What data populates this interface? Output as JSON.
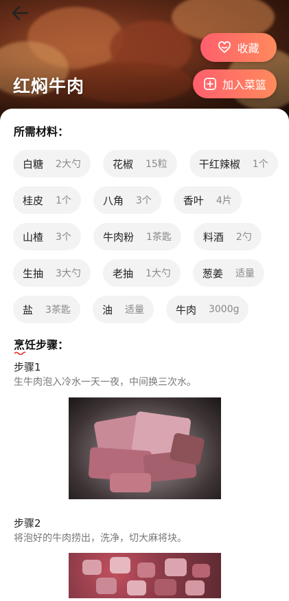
{
  "header": {
    "title": "红焖牛肉",
    "favorite_label": "收藏",
    "add_basket_label": "加入菜篮"
  },
  "ingredients": {
    "heading": "所需材料：",
    "items": [
      {
        "name": "白糖",
        "qty": "2大勺"
      },
      {
        "name": "花椒",
        "qty": "15粒"
      },
      {
        "name": "干红辣椒",
        "qty": "1个"
      },
      {
        "name": "桂皮",
        "qty": "1个"
      },
      {
        "name": "八角",
        "qty": "3个"
      },
      {
        "name": "香叶",
        "qty": "4片"
      },
      {
        "name": "山楂",
        "qty": "3个"
      },
      {
        "name": "牛肉粉",
        "qty": "1茶匙"
      },
      {
        "name": "料酒",
        "qty": "2勺"
      },
      {
        "name": "生抽",
        "qty": "3大勺"
      },
      {
        "name": "老抽",
        "qty": "1大勺"
      },
      {
        "name": "葱姜",
        "qty": "适量"
      },
      {
        "name": "盐",
        "qty": "3茶匙"
      },
      {
        "name": "油",
        "qty": "适量"
      },
      {
        "name": "牛肉",
        "qty": "3000g"
      }
    ]
  },
  "steps": {
    "heading": "烹饪步骤：",
    "items": [
      {
        "title": "步骤1",
        "desc": "生牛肉泡入冷水一天一夜，中间换三次水。"
      },
      {
        "title": "步骤2",
        "desc": "将泡好的牛肉捞出，洗净，切大麻将块。"
      }
    ]
  },
  "icons": {
    "back": "back-arrow-icon",
    "favorite": "heart-icon",
    "add": "plus-square-icon"
  },
  "colors": {
    "accent_start": "#ff5f6d",
    "accent_end": "#ff8a5c"
  }
}
